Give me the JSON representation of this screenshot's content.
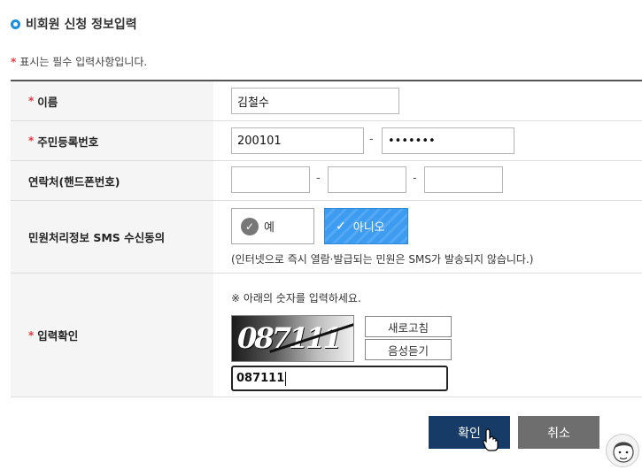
{
  "section": {
    "title": "비회원 신청 정보입력"
  },
  "required_note": "표시는 필수 입력사항입니다.",
  "required_mark": "*",
  "fields": {
    "name": {
      "label": "이름",
      "value": "김철수"
    },
    "jumin": {
      "label": "주민등록번호",
      "front": "200101",
      "dash": "-",
      "back": "•••••••"
    },
    "phone": {
      "label": "연락처(핸드폰번호)",
      "dash1": "-",
      "dash2": "-",
      "part1": "",
      "part2": "",
      "part3": ""
    },
    "sms": {
      "label": "민원처리정보 SMS 수신동의",
      "yes": "예",
      "no": "아니오",
      "selected": "아니오",
      "note": "(인터넷으로 즉시 열람·발급되는 민원은 SMS가 발송되지 않습니다.)"
    },
    "captcha": {
      "label": "입력확인",
      "note": "※ 아래의 숫자를 입력하세요.",
      "image_text": "087111",
      "refresh": "새로고침",
      "audio": "음성듣기",
      "value": "087111"
    }
  },
  "buttons": {
    "ok": "확인",
    "cancel": "취소"
  },
  "colors": {
    "accent": "#1a8fe0",
    "required": "#e8383d",
    "primary_button": "#163b66",
    "secondary_button": "#6e6e6e",
    "selected_radio": "#3d9bf0"
  },
  "icons": {
    "section": "ring-icon",
    "check": "check-icon",
    "cursor": "hand-cursor-icon",
    "avatar": "avatar"
  }
}
